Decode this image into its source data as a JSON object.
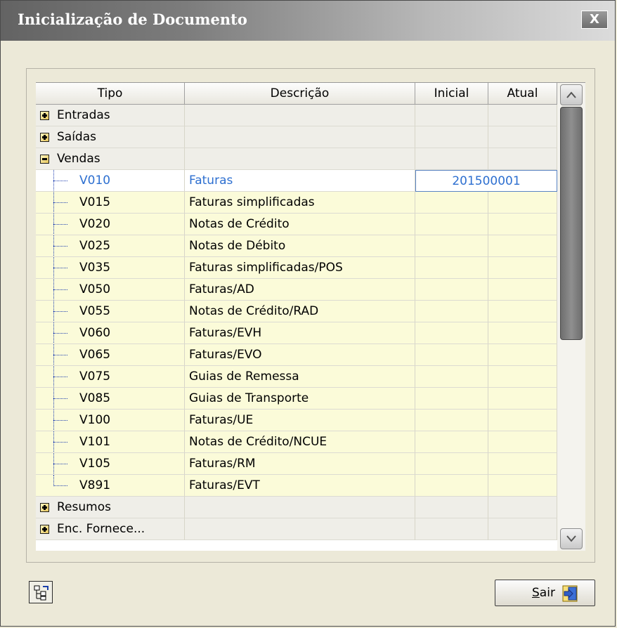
{
  "window": {
    "title": "Inicialização de Documento",
    "close_label": "X"
  },
  "grid": {
    "columns": [
      "Tipo",
      "Descrição",
      "Inicial",
      "Atual"
    ],
    "groups_before": [
      "Entradas",
      "Saídas"
    ],
    "expanded_group": "Vendas",
    "rows": [
      {
        "code": "V010",
        "description": "Faturas",
        "atual": "201500001"
      },
      {
        "code": "V015",
        "description": "Faturas simplificadas"
      },
      {
        "code": "V020",
        "description": "Notas de Crédito"
      },
      {
        "code": "V025",
        "description": "Notas de Débito"
      },
      {
        "code": "V035",
        "description": "Faturas simplificadas/POS"
      },
      {
        "code": "V050",
        "description": "Faturas/AD"
      },
      {
        "code": "V055",
        "description": "Notas de Crédito/RAD"
      },
      {
        "code": "V060",
        "description": "Faturas/EVH"
      },
      {
        "code": "V065",
        "description": "Faturas/EVO"
      },
      {
        "code": "V075",
        "description": "Guias de Remessa"
      },
      {
        "code": "V085",
        "description": "Guias de Transporte"
      },
      {
        "code": "V100",
        "description": "Faturas/UE"
      },
      {
        "code": "V101",
        "description": "Notas de Crédito/NCUE"
      },
      {
        "code": "V105",
        "description": "Faturas/RM"
      },
      {
        "code": "V891",
        "description": "Faturas/EVT"
      }
    ],
    "groups_after": [
      "Resumos",
      "Enc. Fornece..."
    ]
  },
  "buttons": {
    "tree_icon": "tree-structure-icon",
    "exit": {
      "accel": "S",
      "rest": "air",
      "icon": "exit-door-icon"
    }
  },
  "colors": {
    "row_highlight": "#fbfbd9",
    "selected_text": "#2d6fd0",
    "group_row": "#efeee8"
  }
}
